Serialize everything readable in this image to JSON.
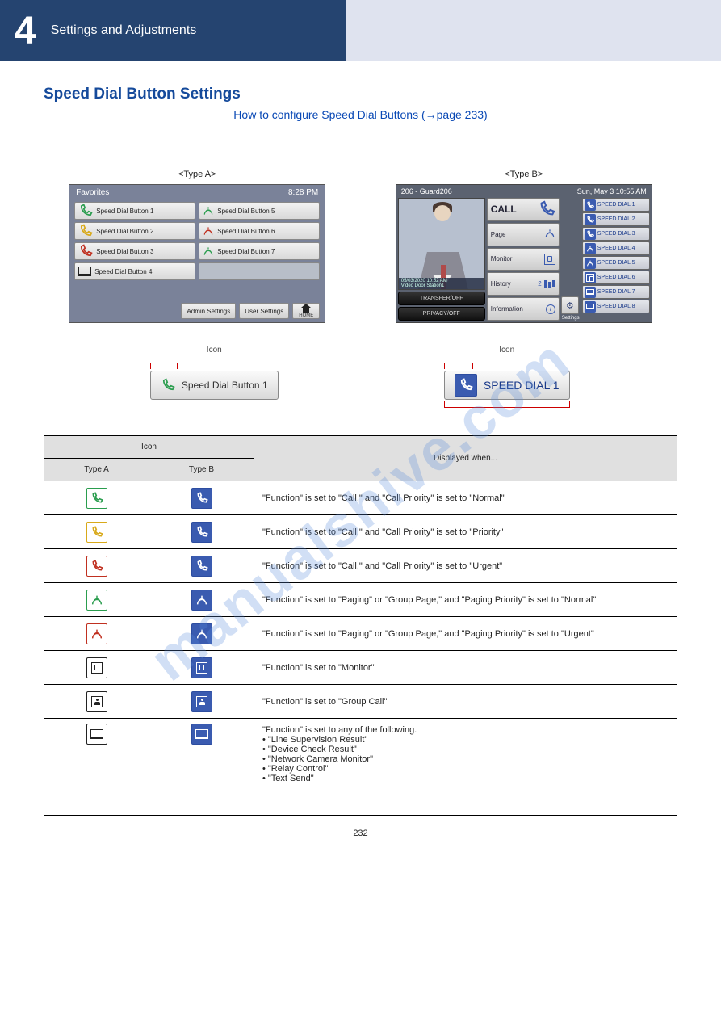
{
  "header": {
    "chapter": "4",
    "section": "Settings and Adjustments"
  },
  "main": {
    "title": "Speed Dial Button Settings",
    "link": "How to configure Speed Dial Buttons (→page 233)",
    "fig1_label": "<Type A>",
    "fig2_label": "<Type B>",
    "sc1": {
      "title": "Favorites",
      "time": "8:28 PM",
      "buttons": [
        "Speed Dial Button 1",
        "Speed Dial Button 2",
        "Speed Dial Button 3",
        "Speed Dial Button 4",
        "Speed Dial Button 5",
        "Speed Dial Button 6",
        "Speed Dial Button 7"
      ],
      "admin": "Admin Settings",
      "user": "User Settings",
      "home": "HOME"
    },
    "sc2": {
      "title": "206 - Guard206",
      "date": "Sun, May 3 10:55 AM",
      "caption_time": "05/03/2020 10:52 AM",
      "caption_src": "Video Door Station1",
      "transfer": "TRANSFER/OFF",
      "privacy": "PRIVACY/OFF",
      "mid": [
        "CALL",
        "Page",
        "Monitor",
        "History",
        "Information"
      ],
      "hist_n": "2",
      "settings": "Settings",
      "sd": [
        "SPEED DIAL 1",
        "SPEED DIAL 2",
        "SPEED DIAL 3",
        "SPEED DIAL 4",
        "SPEED DIAL 5",
        "SPEED DIAL 6",
        "SPEED DIAL 7",
        "SPEED DIAL 8"
      ]
    },
    "enl": {
      "a_text": "Speed Dial Button 1",
      "b_text": "SPEED DIAL 1",
      "icon_lbl": "Icon"
    },
    "tbl": {
      "h_icon": "Icon",
      "h_a": "Type A",
      "h_b": "Type B",
      "h_desc": "Displayed when...",
      "rows": [
        "\"Function\" is set to \"Call,\" and \"Call Priority\" is set to \"Normal\"",
        "\"Function\" is set to \"Call,\" and \"Call Priority\" is set to \"Priority\"",
        "\"Function\" is set to \"Call,\" and \"Call Priority\" is set to \"Urgent\"",
        "\"Function\" is set to \"Paging\" or \"Group Page,\" and \"Paging Priority\" is set to \"Normal\"",
        "\"Function\" is set to \"Paging\" or \"Group Page,\" and \"Paging Priority\" is set to \"Urgent\"",
        "\"Function\" is set to \"Monitor\"",
        "\"Function\" is set to \"Group Call\"",
        "\"Function\" is set to any of the following.\n• \"Line Supervision Result\"\n• \"Device Check Result\"\n• \"Network Camera Monitor\"\n• \"Relay Control\"\n• \"Text Send\""
      ]
    }
  },
  "page_num": "232"
}
